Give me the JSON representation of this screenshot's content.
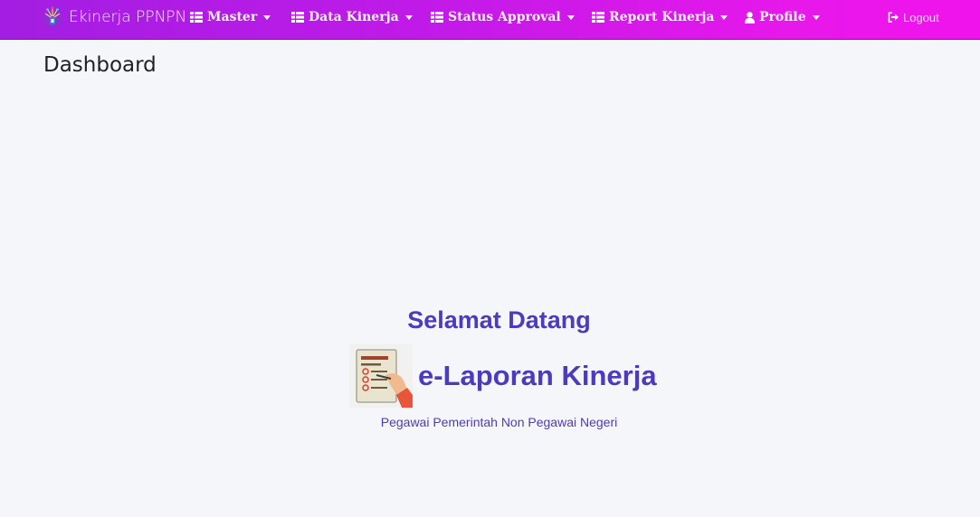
{
  "brand": {
    "name": "Ekinerja PPNPN",
    "logo_icon": "emblem-logo-icon"
  },
  "nav": {
    "items": [
      {
        "label": "Master",
        "icon": "table-icon"
      },
      {
        "label": "Data Kinerja",
        "icon": "table-icon"
      },
      {
        "label": "Status Approval",
        "icon": "table-icon"
      },
      {
        "label": "Report Kinerja",
        "icon": "table-icon"
      },
      {
        "label": "Profile",
        "icon": "user-icon"
      }
    ],
    "logout": {
      "label": "Logout",
      "icon": "sign-out-icon"
    }
  },
  "page": {
    "title": "Dashboard"
  },
  "hero": {
    "greeting": "Selamat Datang",
    "title": "e-Laporan Kinerja",
    "subtitle": "Pegawai Pemerintah Non Pegawai Negeri",
    "illustration": "checklist-report-icon"
  },
  "colors": {
    "navbar_start": "#a21ee2",
    "navbar_end": "#f113ec",
    "accent": "#4b3bbd",
    "background": "#f5f6fa"
  }
}
